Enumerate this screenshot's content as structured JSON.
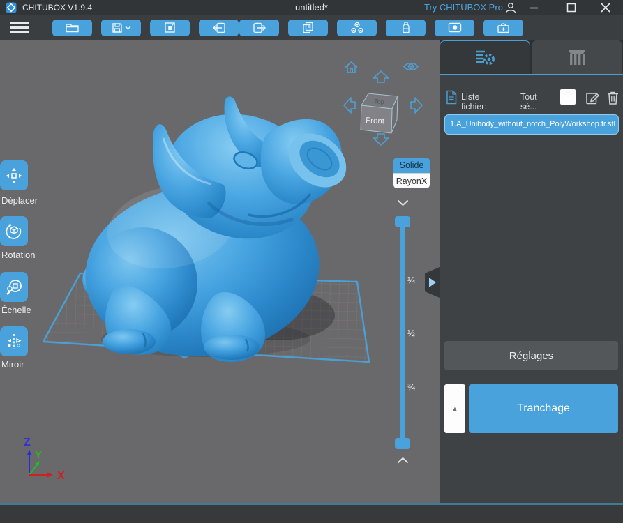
{
  "titlebar": {
    "app_title": "CHITUBOX V1.9.4",
    "document_title": "untitled*",
    "pro_link": "Try CHITUBOX Pro"
  },
  "toolbar": {
    "buttons": [
      "open",
      "save",
      "fit-plate",
      "import-model",
      "export-model",
      "copy",
      "auto-arrange",
      "resin",
      "snapshot",
      "toolbox"
    ]
  },
  "left_tools": [
    {
      "id": "move",
      "label": "Déplacer"
    },
    {
      "id": "rotate",
      "label": "Rotation"
    },
    {
      "id": "scale",
      "label": "Échelle"
    },
    {
      "id": "mirror",
      "label": "Miroir"
    }
  ],
  "viewport": {
    "view_modes": [
      {
        "label": "Solide",
        "active": true
      },
      {
        "label": "RayonX",
        "active": false
      }
    ],
    "slider_labels": [
      "¼",
      "½",
      "¾"
    ],
    "nav_cube": {
      "front_label": "Front",
      "top_label": "Top"
    },
    "axes": {
      "x": "X",
      "y": "Y",
      "z": "Z"
    }
  },
  "right_panel": {
    "tabs": [
      {
        "name": "file-settings",
        "active": true
      },
      {
        "name": "support",
        "active": false
      }
    ],
    "file_list_label": "Liste fichier:",
    "select_all_label": "Tout sé...",
    "files": [
      {
        "name": "1.A_Unibody_without_notch_PolyWorkshop.fr.stl",
        "selected": true
      }
    ],
    "settings_button_label": "Réglages",
    "slice_button_label": "Tranchage"
  },
  "colors": {
    "accent": "#4aa2dc",
    "model_blue": "#3d9ddd",
    "viewport_bg": "#69696c",
    "panel_bg": "#3f4245",
    "plate_outline": "#4a9fd4"
  }
}
